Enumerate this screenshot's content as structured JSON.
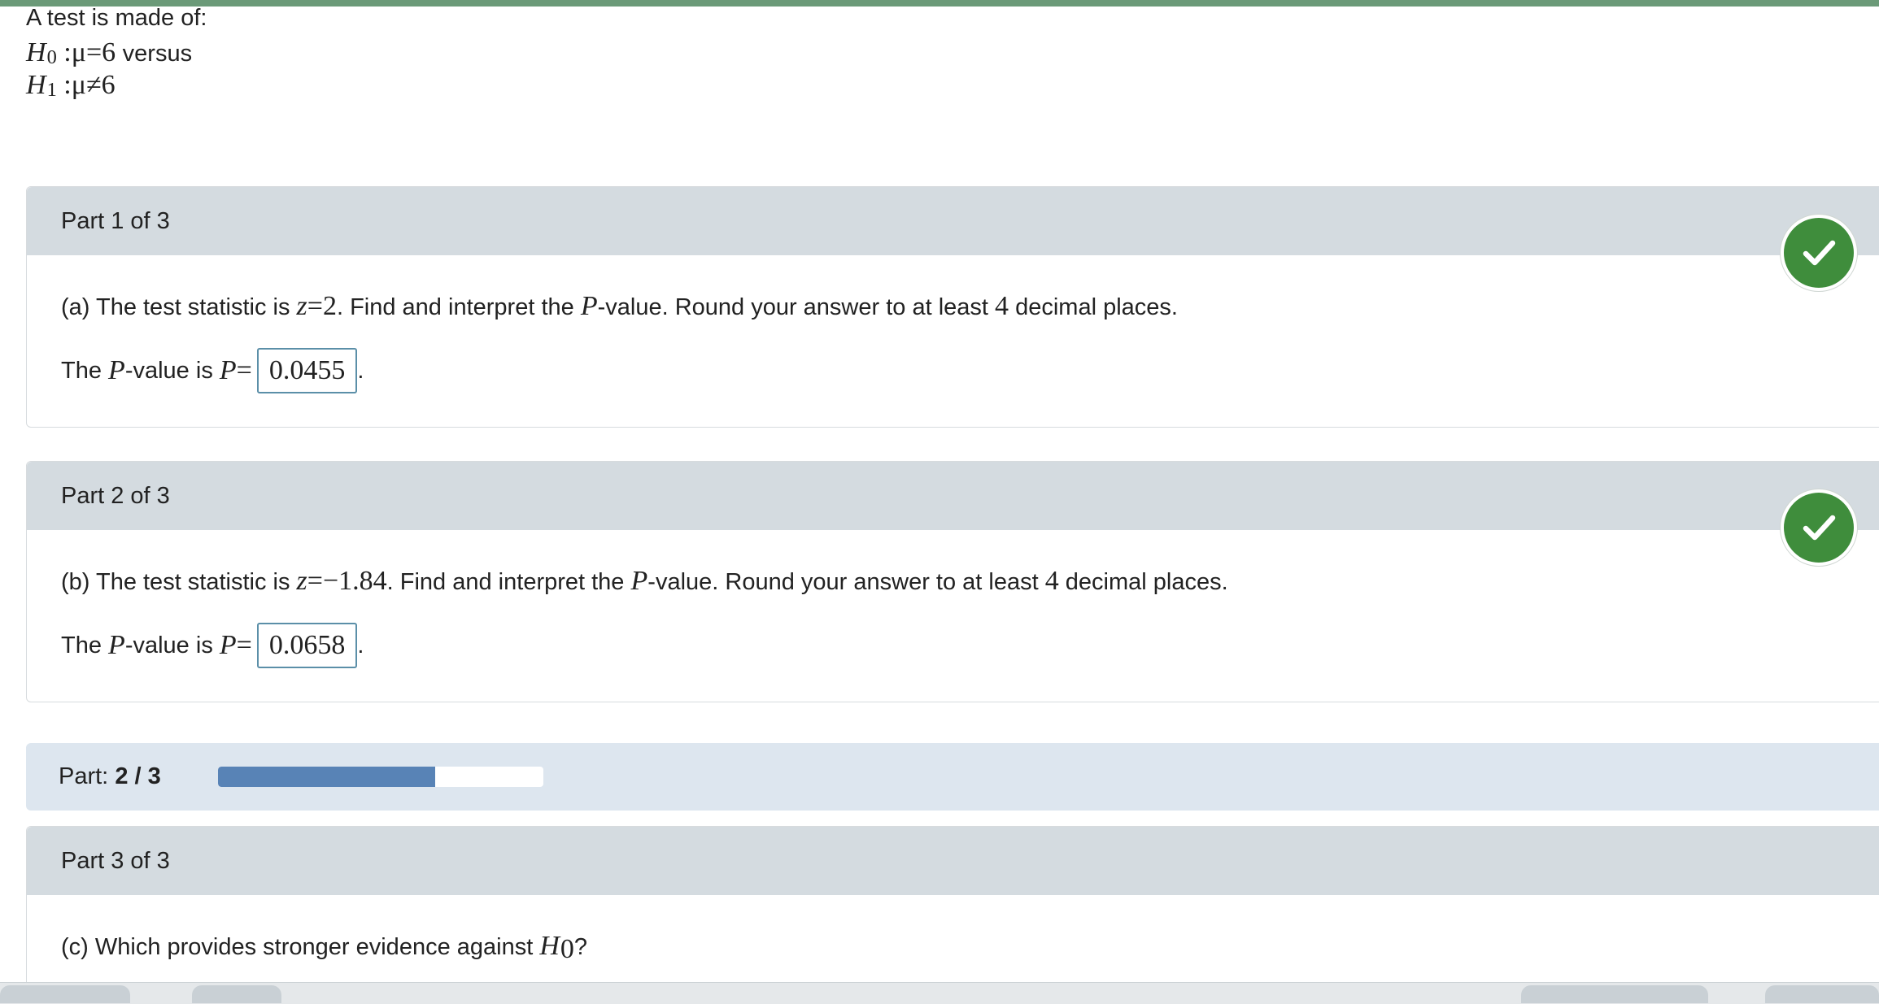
{
  "intro": "A test is made of:",
  "hypotheses": {
    "null": {
      "sym": "H",
      "sub": "0",
      "colon": ":",
      "mu": "μ",
      "op": "=",
      "val": "6",
      "versus": "versus"
    },
    "alt": {
      "sym": "H",
      "sub": "1",
      "colon": ":",
      "mu": "μ",
      "op": "≠",
      "val": "6"
    }
  },
  "parts": [
    {
      "header": "Part 1 of 3",
      "q_prefix": "(a) The test statistic is ",
      "q_z": "z",
      "q_eq": "=",
      "q_zval": "2",
      "q_mid": ". Find and interpret the ",
      "q_p": "P",
      "q_mid2": "-value. Round your answer to at least ",
      "q_n": "4",
      "q_suffix": " decimal places.",
      "ans_prefix": "The ",
      "ans_p": "P",
      "ans_mid": "-value is ",
      "ans_p2": "P",
      "ans_eq": "=",
      "answer": "0.0455",
      "ans_end": ".",
      "status": "correct"
    },
    {
      "header": "Part 2 of 3",
      "q_prefix": "(b) The test statistic is ",
      "q_z": "z",
      "q_eq": "=",
      "q_zval": "−1.84",
      "q_mid": ". Find and interpret the ",
      "q_p": "P",
      "q_mid2": "-value. Round your answer to at least ",
      "q_n": "4",
      "q_suffix": " decimal places.",
      "ans_prefix": "The ",
      "ans_p": "P",
      "ans_mid": "-value is ",
      "ans_p2": "P",
      "ans_eq": "=",
      "answer": "0.0658",
      "ans_end": ".",
      "status": "correct"
    }
  ],
  "progress": {
    "label": "Part: ",
    "value": "2 / 3",
    "fraction": 0.667
  },
  "part3": {
    "header": "Part 3 of 3",
    "q_prefix": "(c) Which provides stronger evidence against ",
    "q_sym": "H",
    "q_sub": "0",
    "q_suffix": "?"
  },
  "colors": {
    "topbar": "#6b9a78",
    "check": "#3f8d3c",
    "progress_fill": "#5883b6",
    "header_bg": "#d4dbe0"
  },
  "icons": {
    "correct": "check-circle-icon"
  }
}
